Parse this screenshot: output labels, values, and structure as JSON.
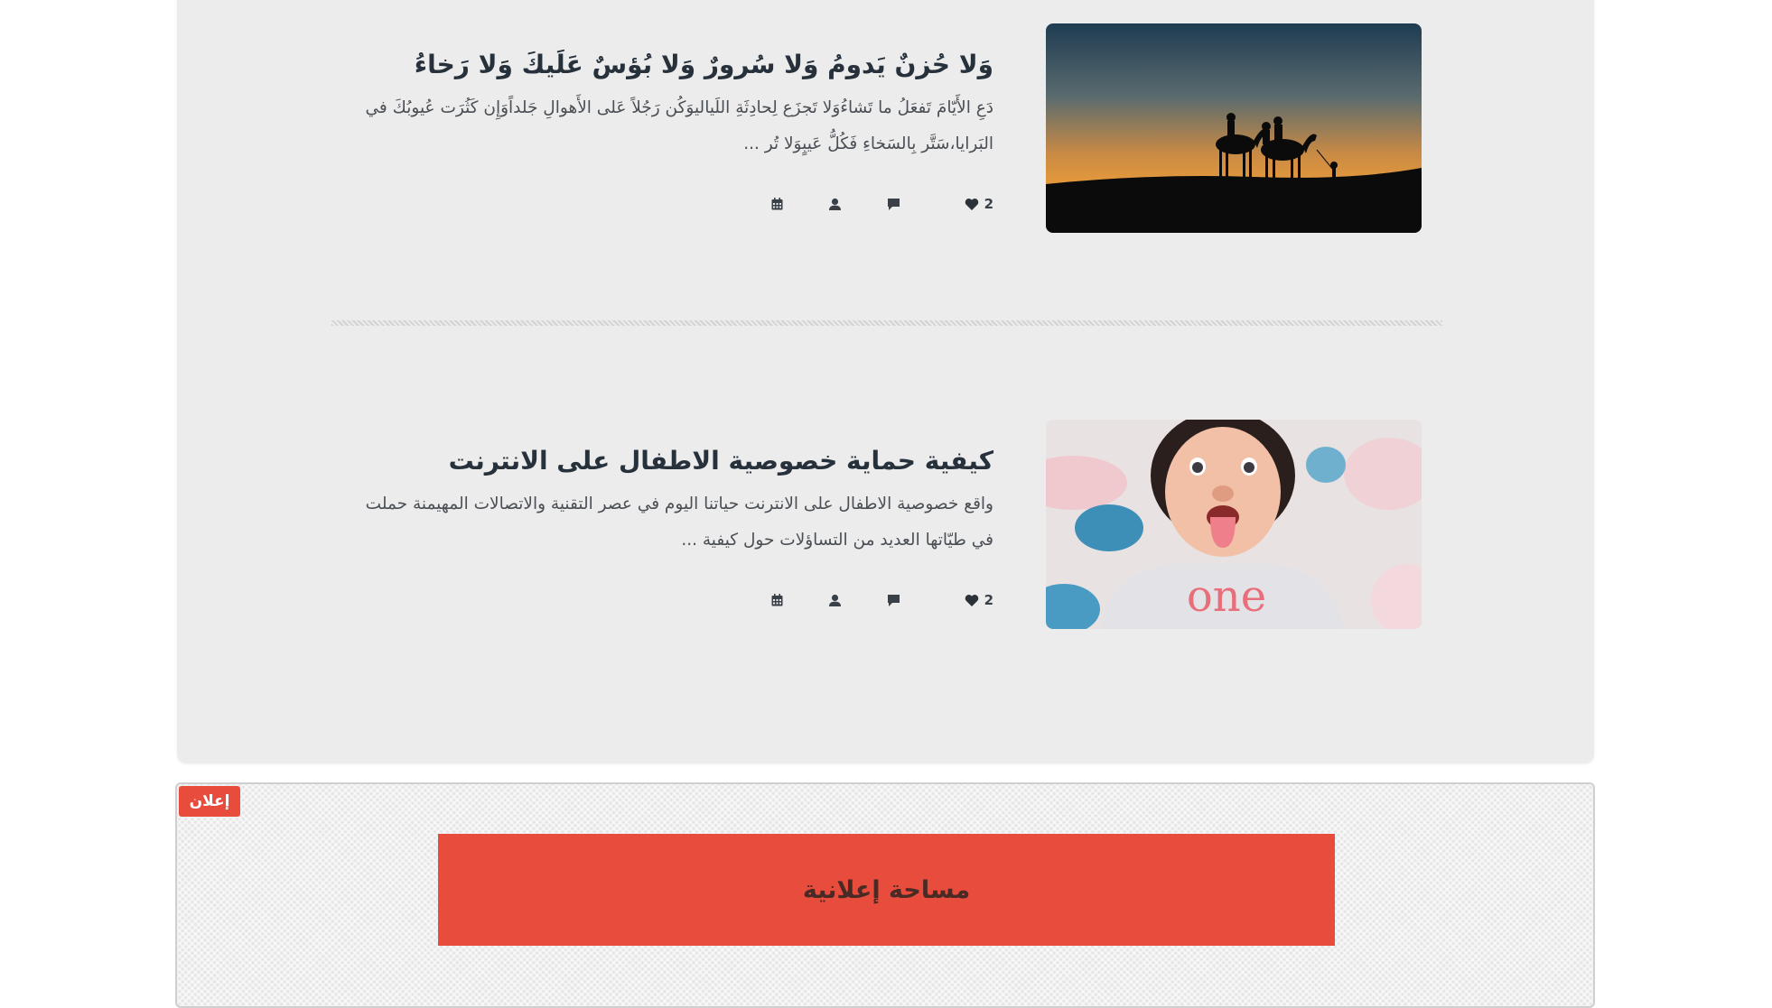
{
  "posts": [
    {
      "title": "وَلا حُزنٌ يَدومُ وَلا سُرورٌ وَلا بُؤسٌ عَلَيكَ وَلا رَخاءُ",
      "excerpt": "دَعِ الأَيّامَ تَفعَلُ ما تَشاءُوَلا تَجزَع لِحادِثَةِ اللَياليوَكُن رَجُلاً عَلى الأَهوالِ جَلداًوَإِن كَثُرَت عُيوبُكَ في البَرايا،سَتَّر بِالسَخاءِ فَكُلُّ عَيبٍوَلا تُر ...",
      "likes": "2",
      "image": "desert-camel-caravan-sunset"
    },
    {
      "title": "كيفية حماية خصوصية الاطفال على الانترنت",
      "excerpt": "واقع خصوصية الاطفال على الانترنت حياتنا اليوم في عصر التقنية والاتصالات المهيمنة حملت في طيّاتها العديد من التساؤلات حول كيفية ...",
      "likes": "2",
      "image": "baby-sticking-out-tongue"
    }
  ],
  "icons": {
    "likes": "heart-icon",
    "comments": "comment-icon",
    "author": "user-icon",
    "date": "calendar-icon"
  },
  "ad": {
    "badge": "إعلان",
    "banner_text": "مساحة إعلانية"
  },
  "colors": {
    "accent": "#e74c3c",
    "panel_bg": "#ececec",
    "title": "#27313b"
  }
}
